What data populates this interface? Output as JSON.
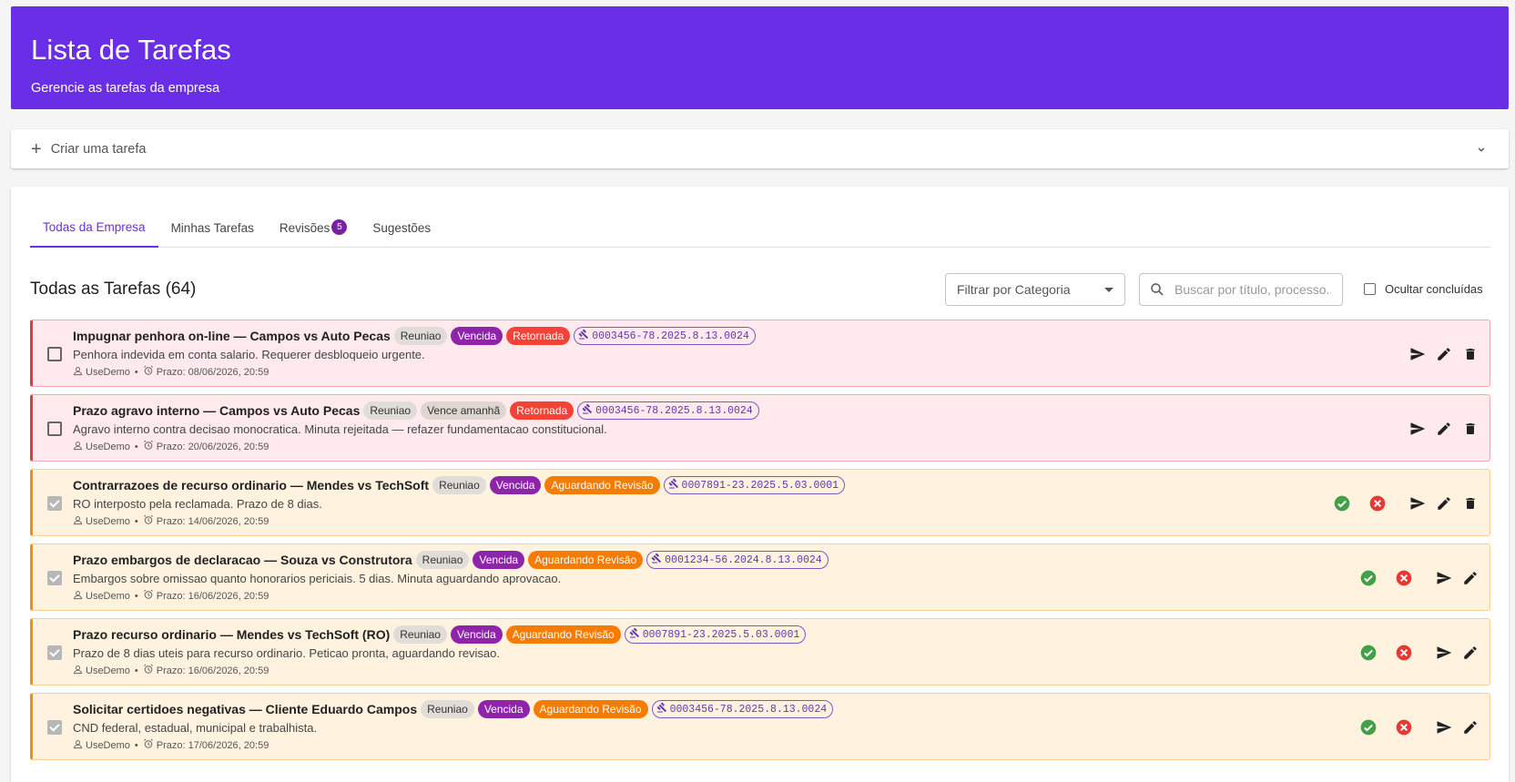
{
  "header": {
    "title": "Lista de Tarefas",
    "subtitle": "Gerencie as tarefas da empresa"
  },
  "create": {
    "label": "Criar uma tarefa",
    "icons": {
      "add": "plus-icon",
      "expand": "chevron-down-icon"
    }
  },
  "tabs": [
    {
      "label": "Todas da Empresa",
      "active": true
    },
    {
      "label": "Minhas Tarefas",
      "active": false
    },
    {
      "label": "Revisões",
      "badge": "5",
      "active": false
    },
    {
      "label": "Sugestões",
      "active": false
    }
  ],
  "list": {
    "title": "Todas as Tarefas (64)",
    "filter_label": "Filtrar por Categoria",
    "search_placeholder": "Buscar por título, processo...",
    "hide_done_label": "Ocultar concluídas"
  },
  "colors": {
    "brand": "#6a2ee6",
    "overdue": "#8e24aa",
    "returned": "#f44336",
    "awaiting_review": "#f57c00",
    "approve": "#43a047",
    "reject": "#e53935"
  },
  "tasks": [
    {
      "title": "Impugnar penhora on-line — Campos vs Auto Pecas",
      "category": "Reuniao",
      "due_status": "Vencida",
      "state": "Retornada",
      "process": "0003456-78.2025.8.13.0024",
      "description": "Penhora indevida em conta salario. Requerer desbloqueio urgente.",
      "user": "UseDemo",
      "deadline": "Prazo: 08/06/2026, 20:59"
    },
    {
      "title": "Prazo agravo interno — Campos vs Auto Pecas",
      "category": "Reuniao",
      "due_status": "Vence amanhã",
      "state": "Retornada",
      "process": "0003456-78.2025.8.13.0024",
      "description": "Agravo interno contra decisao monocratica. Minuta rejeitada — refazer fundamentacao constitucional.",
      "user": "UseDemo",
      "deadline": "Prazo: 20/06/2026, 20:59"
    },
    {
      "title": "Contrarrazoes de recurso ordinario — Mendes vs TechSoft",
      "category": "Reuniao",
      "due_status": "Vencida",
      "state": "Aguardando Revisão",
      "process": "0007891-23.2025.5.03.0001",
      "description": "RO interposto pela reclamada. Prazo de 8 dias.",
      "user": "UseDemo",
      "deadline": "Prazo: 14/06/2026, 20:59"
    },
    {
      "title": "Prazo embargos de declaracao — Souza vs Construtora",
      "category": "Reuniao",
      "due_status": "Vencida",
      "state": "Aguardando Revisão",
      "process": "0001234-56.2024.8.13.0024",
      "description": "Embargos sobre omissao quanto honorarios periciais. 5 dias. Minuta aguardando aprovacao.",
      "user": "UseDemo",
      "deadline": "Prazo: 16/06/2026, 20:59"
    },
    {
      "title": "Prazo recurso ordinario — Mendes vs TechSoft (RO)",
      "category": "Reuniao",
      "due_status": "Vencida",
      "state": "Aguardando Revisão",
      "process": "0007891-23.2025.5.03.0001",
      "description": "Prazo de 8 dias uteis para recurso ordinario. Peticao pronta, aguardando revisao.",
      "user": "UseDemo",
      "deadline": "Prazo: 16/06/2026, 20:59"
    },
    {
      "title": "Solicitar certidoes negativas — Cliente Eduardo Campos",
      "category": "Reuniao",
      "due_status": "Vencida",
      "state": "Aguardando Revisão",
      "process": "0003456-78.2025.8.13.0024",
      "description": "CND federal, estadual, municipal e trabalhista.",
      "user": "UseDemo",
      "deadline": "Prazo: 17/06/2026, 20:59"
    }
  ]
}
